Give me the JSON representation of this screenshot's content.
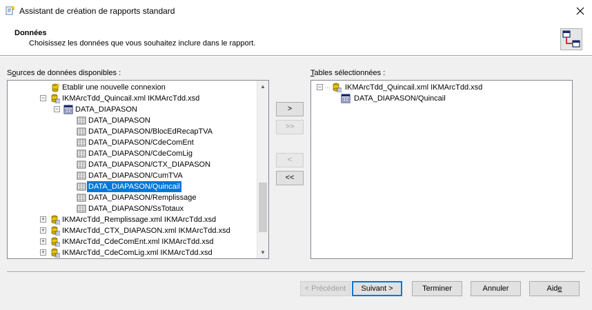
{
  "window": {
    "title": "Assistant de création de rapports standard"
  },
  "header": {
    "title": "Données",
    "description": "Choisissez les données que vous souhaitez inclure dans le rapport."
  },
  "sources": {
    "label_pre": "S",
    "label_ul": "o",
    "label_post": "urces de données disponibles :",
    "items": [
      {
        "text": "Etablir une nouvelle connexion"
      },
      {
        "text": "IKMArcTdd_Quincail.xml IKMArcTdd.xsd"
      },
      {
        "text": "DATA_DIAPASON"
      },
      {
        "text": "DATA_DIAPASON"
      },
      {
        "text": "DATA_DIAPASON/BlocEdRecapTVA"
      },
      {
        "text": "DATA_DIAPASON/CdeComEnt"
      },
      {
        "text": "DATA_DIAPASON/CdeComLig"
      },
      {
        "text": "DATA_DIAPASON/CTX_DIAPASON"
      },
      {
        "text": "DATA_DIAPASON/CumTVA"
      },
      {
        "text": "DATA_DIAPASON/Quincail"
      },
      {
        "text": "DATA_DIAPASON/Remplissage"
      },
      {
        "text": "DATA_DIAPASON/SsTotaux"
      },
      {
        "text": "IKMArcTdd_Remplissage.xml IKMArcTdd.xsd"
      },
      {
        "text": "IKMArcTdd_CTX_DIAPASON.xml IKMArcTdd.xsd"
      },
      {
        "text": "IKMArcTdd_CdeComEnt.xml IKMArcTdd.xsd"
      },
      {
        "text": "IKMArcTdd_CdeComLig.xml IKMArcTdd.xsd"
      }
    ]
  },
  "selected": {
    "label_ul": "T",
    "label_post": "ables sélectionnées :",
    "items": [
      {
        "text": "IKMArcTdd_Quincail.xml IKMArcTdd.xsd"
      },
      {
        "text": "DATA_DIAPASON/Quincail"
      }
    ]
  },
  "move_buttons": {
    "add": ">",
    "add_all": ">>",
    "remove": "<",
    "remove_all": "<<"
  },
  "footer": {
    "previous": "< Précédent",
    "next": "Suivant >",
    "finish": "Terminer",
    "cancel": "Annuler",
    "help_pre": "Aid",
    "help_ul": "e"
  },
  "colors": {
    "selection": "#0078d7",
    "panel": "#f0f0f0"
  }
}
